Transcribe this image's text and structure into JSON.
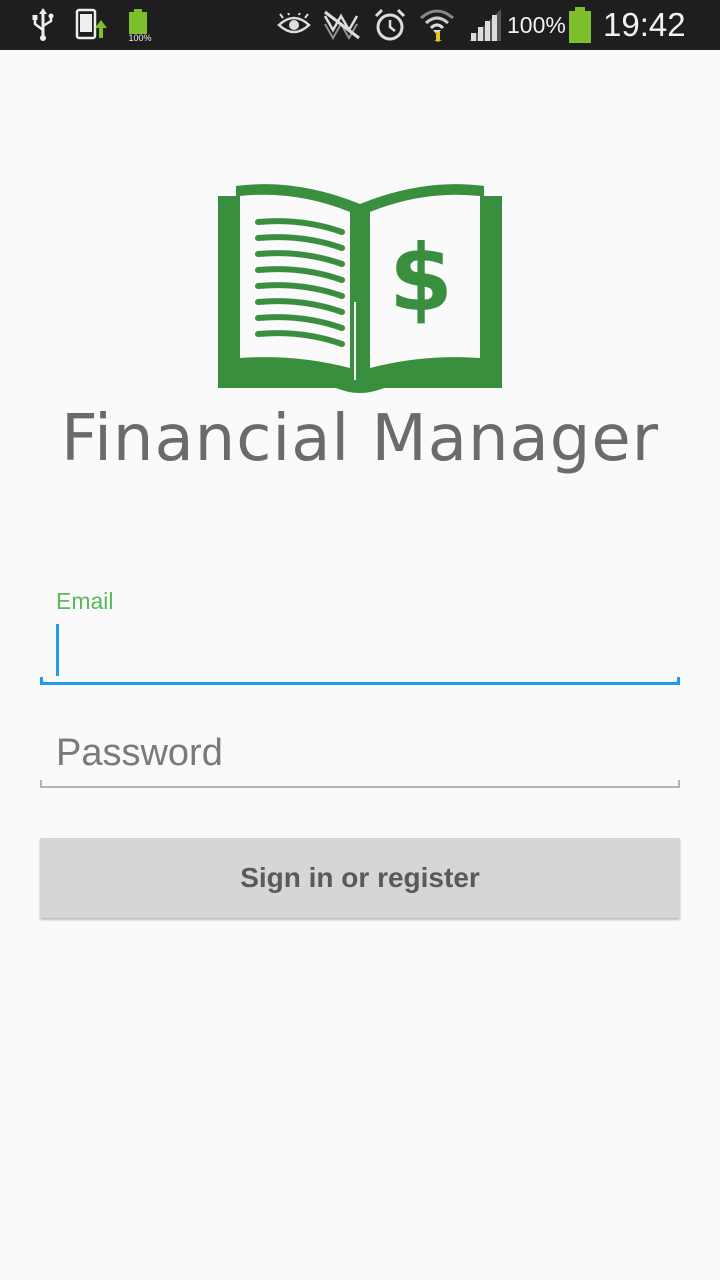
{
  "status_bar": {
    "battery_small_label": "100%",
    "battery_percent": "100%",
    "clock": "19:42",
    "icons": [
      "usb-icon",
      "phone-update-icon",
      "battery-small-icon",
      "eye-icon",
      "mute-icon",
      "alarm-icon",
      "wifi-icon",
      "signal-icon",
      "battery-icon"
    ]
  },
  "app": {
    "title": "Financial Manager",
    "logo_symbol": "$",
    "brand_color": "#3a8f3f"
  },
  "form": {
    "email_label": "Email",
    "email_value": "",
    "password_placeholder": "Password",
    "submit_label": "Sign in or register",
    "accent_color": "#1e9ce6",
    "label_color": "#5cb85c"
  }
}
